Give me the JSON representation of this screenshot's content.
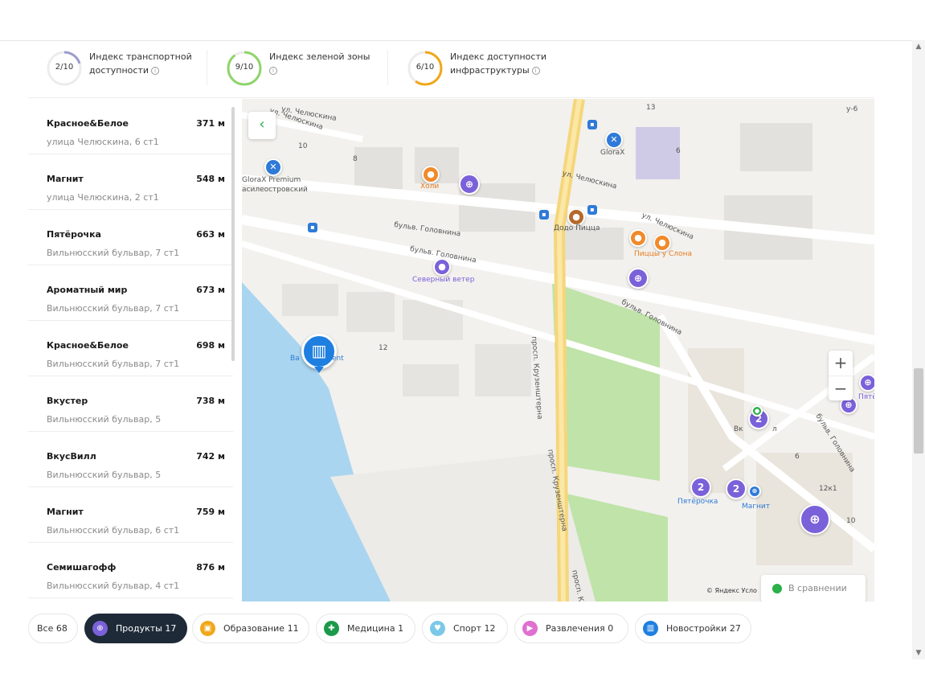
{
  "indices": [
    {
      "score": "2/10",
      "label": "Индекс транспортной доступности",
      "color": "#9c9ccc",
      "fraction": 0.2
    },
    {
      "score": "9/10",
      "label": "Индекс зеленой зоны",
      "color": "#8fd46a",
      "fraction": 0.9
    },
    {
      "score": "6/10",
      "label": "Индекс доступности инфраструктуры",
      "color": "#f0a818",
      "fraction": 0.6
    }
  ],
  "info_icon": "ⓘ",
  "places": [
    {
      "name": "Красное&Белое",
      "distance": "371 м",
      "address": "улица Челюскина, 6 ст1"
    },
    {
      "name": "Магнит",
      "distance": "548 м",
      "address": "улица Челюскина, 2 ст1"
    },
    {
      "name": "Пятёрочка",
      "distance": "663 м",
      "address": "Вильнюсский бульвар, 7 ст1"
    },
    {
      "name": "Ароматный мир",
      "distance": "673 м",
      "address": "Вильнюсский бульвар, 7 ст1"
    },
    {
      "name": "Красное&Белое",
      "distance": "698 м",
      "address": "Вильнюсский бульвар, 7 ст1"
    },
    {
      "name": "Вкустер",
      "distance": "738 м",
      "address": "Вильнюсский бульвар, 5"
    },
    {
      "name": "ВкусВилл",
      "distance": "742 м",
      "address": "Вильнюсский бульвар, 5"
    },
    {
      "name": "Магнит",
      "distance": "759 м",
      "address": "Вильнюсский бульвар, 6 ст1"
    },
    {
      "name": "Семишагофф",
      "distance": "876 м",
      "address": "Вильнюсский бульвар, 4 ст1"
    }
  ],
  "map": {
    "back_icon": "‹",
    "zoom_in": "+",
    "zoom_out": "−",
    "copyright": "© Яндекс Усло",
    "compare_label": "В сравнении",
    "labels": {
      "glorax": "GloraX",
      "glorax_premium": "GloraX Premium",
      "vasileostrovsky": "асилеостровский",
      "holi": "Холи",
      "dodo": "Додо Пицца",
      "slona": "Пиццы у Слона",
      "severny": "Северный ветер",
      "pyaterochka": "Пятёрочка",
      "magnit": "Магнит",
      "pyat_cut": "Пятё",
      "vk": "Вк",
      "vk_end": "л",
      "building": "Ba",
      "building_end": "ent",
      "street1": "ул. Челюскина",
      "street2": "ул. Челюскина",
      "street3": "ул. Челюскина",
      "street4": "ул. Челюскина",
      "blvd1": "бульв. Головнина",
      "blvd2": "бульв. Головнина",
      "blvd3": "бульв. Головнина",
      "blvd4": "бульв. Головнина",
      "prosp1": "просп. Крузенштерна",
      "prosp2": "просп. Крузенштерна",
      "prosp3": "просп. Кр",
      "n13": "13",
      "n10": "10",
      "n8": "8",
      "n6": "6",
      "n12": "12",
      "n6b": "6",
      "n12k1": "12к1",
      "n10b": "10",
      "y6": "у-6"
    },
    "pin_counts": {
      "a": "2",
      "b": "2",
      "c": "2"
    }
  },
  "chips": [
    {
      "label": "Все",
      "count": "68",
      "color": ""
    },
    {
      "label": "Продукты",
      "count": "17",
      "color": "#7b61d9"
    },
    {
      "label": "Образование",
      "count": "11",
      "color": "#f0a818"
    },
    {
      "label": "Медицина",
      "count": "1",
      "color": "#1a9a4a"
    },
    {
      "label": "Спорт",
      "count": "12",
      "color": "#7cc8e8"
    },
    {
      "label": "Развлечения",
      "count": "0",
      "color": "#e070d0"
    },
    {
      "label": "Новостройки",
      "count": "27",
      "color": "#1f7fe0"
    }
  ]
}
